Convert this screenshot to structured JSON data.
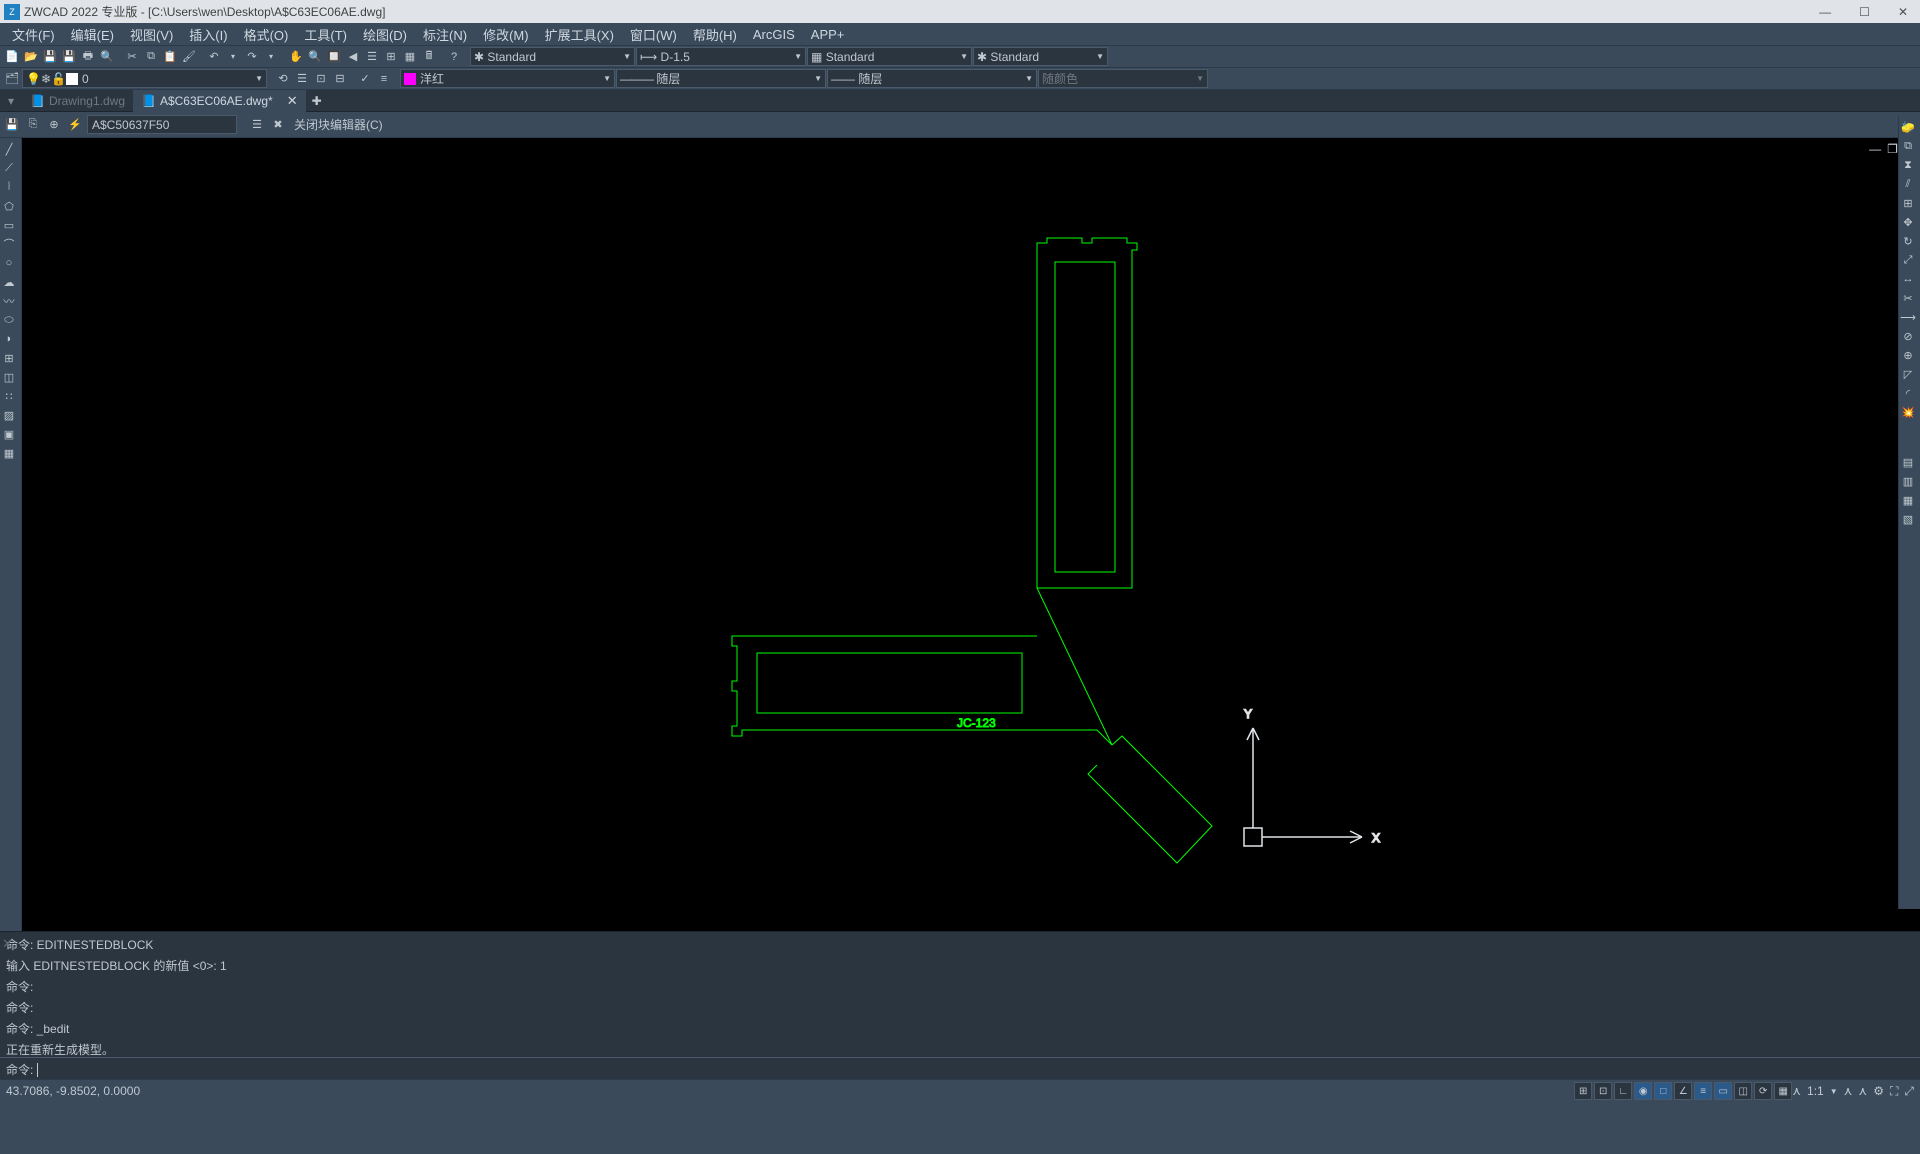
{
  "titlebar": {
    "app": "ZWCAD 2022 专业版",
    "doc_path": "[C:\\Users\\wen\\Desktop\\A$C63EC06AE.dwg]"
  },
  "menubar": [
    "文件(F)",
    "编辑(E)",
    "视图(V)",
    "插入(I)",
    "格式(O)",
    "工具(T)",
    "绘图(D)",
    "标注(N)",
    "修改(M)",
    "扩展工具(X)",
    "窗口(W)",
    "帮助(H)",
    "ArcGIS",
    "APP+"
  ],
  "toolbar_styles": {
    "text_style": "Standard",
    "dim_style": "D-1.5",
    "table_style": "Standard",
    "other_style": "Standard"
  },
  "toolbar_props": {
    "color_name": "洋红",
    "color_hex": "#ff00ff",
    "linetype": "随层",
    "lineweight": "随层",
    "plotstyle": "随颜色"
  },
  "layer_combo": "0",
  "tabs": {
    "inactive": "Drawing1.dwg",
    "active": "A$C63EC06AE.dwg*"
  },
  "blockedit": {
    "block_name": "A$C50637F50",
    "close_label": "关闭块编辑器(C)"
  },
  "drawing_label": "JC-123",
  "axes": {
    "x": "X",
    "y": "Y"
  },
  "command_history": [
    "命令: EDITNESTEDBLOCK",
    "输入 EDITNESTEDBLOCK 的新值 <0>: 1",
    "命令:",
    "命令:",
    "命令: _bedit",
    "正在重新生成模型。"
  ],
  "command_prompt": "命令: ",
  "status": {
    "coords": "43.7086, -9.8502, 0.0000",
    "scale": "1:1"
  }
}
